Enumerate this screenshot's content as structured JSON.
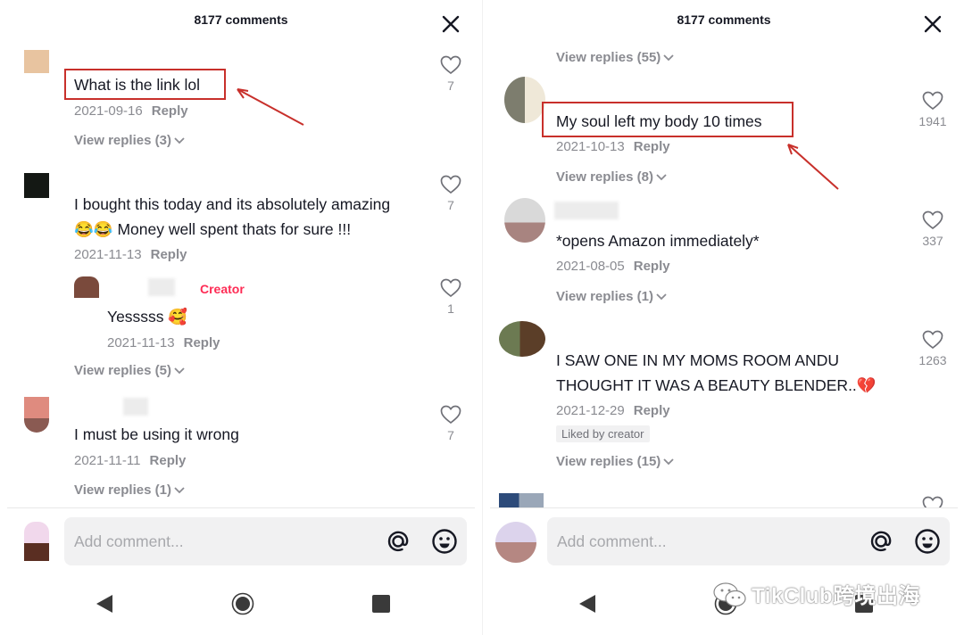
{
  "left": {
    "header": {
      "title": "8177 comments"
    },
    "comments": [
      {
        "text": "What is the link lol",
        "date": "2021-09-16",
        "reply": "Reply",
        "likes": "7",
        "view_replies": "View replies (3)"
      },
      {
        "text_line1": "I bought this today and its absolutely amazing",
        "text_line2": "😂😂 Money well spent thats for sure !!!",
        "date": "2021-11-13",
        "reply": "Reply",
        "likes": "7"
      },
      {
        "creator_tag": "Creator",
        "text": "Yesssss 🥰",
        "date": "2021-11-13",
        "reply": "Reply",
        "likes": "1",
        "view_replies": "View replies (5)"
      },
      {
        "text": "I must be using it wrong",
        "date": "2021-11-11",
        "reply": "Reply",
        "likes": "7",
        "view_replies": "View replies (1)"
      }
    ],
    "input": {
      "placeholder": "Add comment..."
    }
  },
  "right": {
    "header": {
      "title": "8177 comments"
    },
    "top_view_replies": "View replies (55)",
    "comments": [
      {
        "text": "My soul left my body 10 times",
        "date": "2021-10-13",
        "reply": "Reply",
        "likes": "1941",
        "view_replies": "View replies (8)"
      },
      {
        "text": "*opens Amazon immediately*",
        "date": "2021-08-05",
        "reply": "Reply",
        "likes": "337",
        "view_replies": "View replies (1)"
      },
      {
        "text_line1": "I SAW ONE IN MY MOMS ROOM ANDU",
        "text_line2": "THOUGHT IT WAS A BEAUTY BLENDER..💔",
        "date": "2021-12-29",
        "reply": "Reply",
        "liked_by": "Liked by creator",
        "likes": "1263",
        "view_replies": "View replies (15)"
      }
    ],
    "input": {
      "placeholder": "Add comment..."
    }
  },
  "watermark": "TikClub跨境出海",
  "colors": {
    "highlight": "#c8302b",
    "creator": "#fe2c55",
    "meta": "#8a8b91"
  }
}
